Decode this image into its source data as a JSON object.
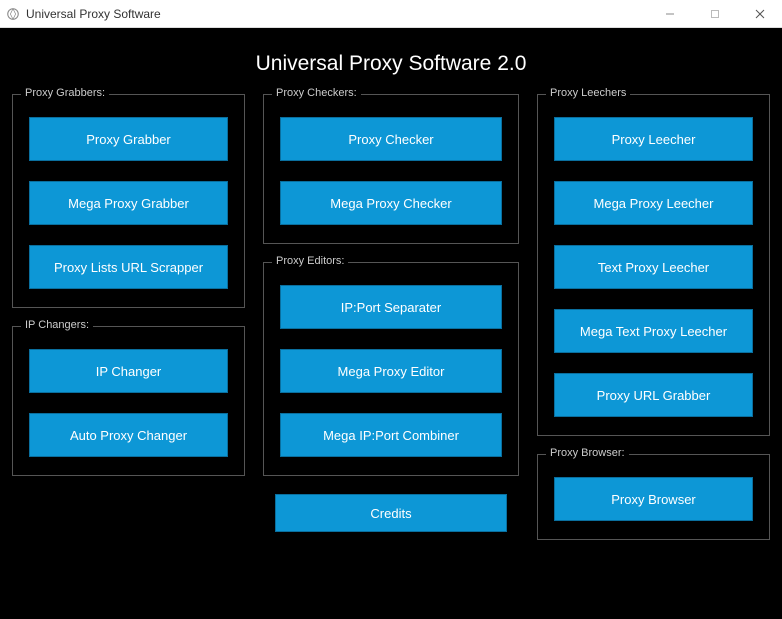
{
  "window": {
    "title": "Universal Proxy Software"
  },
  "app": {
    "title": "Universal Proxy Software 2.0"
  },
  "groups": {
    "grabbers": {
      "legend": "Proxy Grabbers:",
      "b1": "Proxy Grabber",
      "b2": "Mega Proxy Grabber",
      "b3": "Proxy Lists URL Scrapper"
    },
    "ipchangers": {
      "legend": "IP Changers:",
      "b1": "IP Changer",
      "b2": "Auto Proxy Changer"
    },
    "checkers": {
      "legend": "Proxy Checkers:",
      "b1": "Proxy Checker",
      "b2": "Mega Proxy Checker"
    },
    "editors": {
      "legend": "Proxy Editors:",
      "b1": "IP:Port Separater",
      "b2": "Mega Proxy Editor",
      "b3": "Mega IP:Port Combiner"
    },
    "leechers": {
      "legend": "Proxy Leechers",
      "b1": "Proxy Leecher",
      "b2": "Mega Proxy Leecher",
      "b3": "Text Proxy Leecher",
      "b4": "Mega Text Proxy Leecher",
      "b5": "Proxy URL Grabber"
    },
    "browser": {
      "legend": "Proxy Browser:",
      "b1": "Proxy Browser"
    }
  },
  "credits": {
    "label": "Credits"
  }
}
